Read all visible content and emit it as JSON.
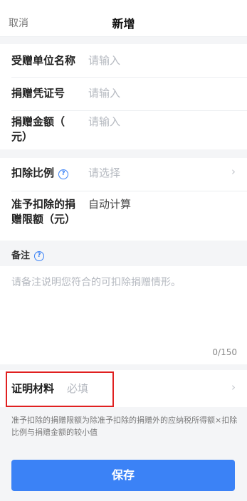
{
  "nav": {
    "cancel": "取消",
    "title": "新增"
  },
  "fields": {
    "recipient": {
      "label": "受赠单位名称",
      "placeholder": "请输入"
    },
    "voucher": {
      "label": "捐赠凭证号",
      "placeholder": "请输入"
    },
    "amount": {
      "label_line1": "捐赠金额（",
      "label_line2": "元）",
      "placeholder": "请输入"
    },
    "ratio": {
      "label": "扣除比例",
      "placeholder": "请选择"
    },
    "limit": {
      "label_line1": "准予扣除的捐",
      "label_line2": "赠限额（元）",
      "value": "自动计算"
    }
  },
  "remark": {
    "label": "备注",
    "placeholder": "请备注说明您符合的可扣除捐赠情形。",
    "count": "0/150"
  },
  "proof": {
    "label": "证明材料",
    "placeholder": "必填"
  },
  "hint": "准予扣除的捐赠限额为除准予扣除的捐赠外的应纳税所得额×扣除比例与捐赠金额的较小值",
  "save_label": "保存",
  "icons": {
    "help": "help-circle-icon",
    "chevron": "chevron-right-icon"
  },
  "colors": {
    "accent": "#3b82f6",
    "highlight": "#e02020"
  }
}
